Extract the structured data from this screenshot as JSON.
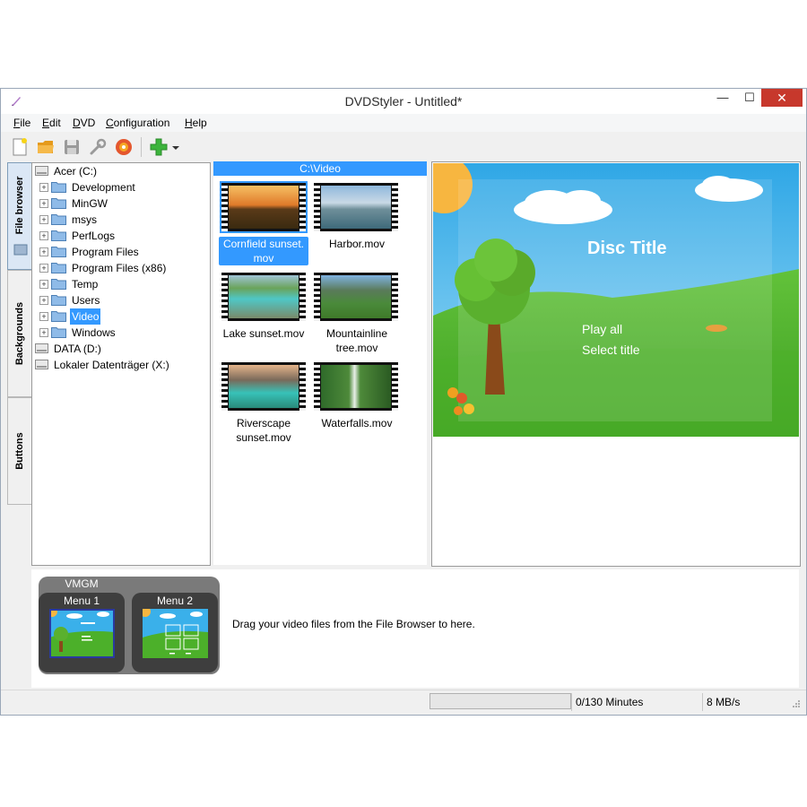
{
  "window": {
    "title": "DVDStyler - Untitled*",
    "controls": {
      "minimize": "—",
      "maximize": "☐",
      "close": "✕"
    }
  },
  "menubar": [
    {
      "underline": "F",
      "rest": "ile"
    },
    {
      "underline": "E",
      "rest": "dit"
    },
    {
      "underline": "D",
      "rest": "VD"
    },
    {
      "underline": "C",
      "rest": "onfiguration"
    },
    {
      "underline": "H",
      "rest": "elp"
    }
  ],
  "toolbar": {
    "icons": [
      "new-file-icon",
      "open-folder-icon",
      "save-icon",
      "settings-wrench-icon",
      "burn-disc-icon",
      "add-icon",
      "dropdown-arrow-icon"
    ]
  },
  "side_tabs": [
    "File browser",
    "Backgrounds",
    "Buttons"
  ],
  "tree": {
    "root": "Acer (C:)",
    "folders": [
      "Development",
      "MinGW",
      "msys",
      "PerfLogs",
      "Program Files",
      "Program Files (x86)",
      "Temp",
      "Users",
      "Video",
      "Windows"
    ],
    "selected": "Video",
    "drives": [
      "DATA (D:)",
      "Lokaler Datenträger (X:)"
    ]
  },
  "file_browser": {
    "path": "C:\\Video",
    "files": [
      {
        "line1": "Cornfield sunset.",
        "line2": "mov",
        "selected": true
      },
      {
        "line1": "Harbor.mov",
        "line2": "",
        "selected": false
      },
      {
        "line1": "Lake sunset.mov",
        "line2": "",
        "selected": false
      },
      {
        "line1": "Mountainline",
        "line2": "tree.mov",
        "selected": false
      },
      {
        "line1": "Riverscape",
        "line2": "sunset.mov",
        "selected": false
      },
      {
        "line1": "Waterfalls.mov",
        "line2": "",
        "selected": false
      }
    ]
  },
  "preview": {
    "disc_title": "Disc Title",
    "buttons": [
      "Play all",
      "Select title"
    ]
  },
  "titleset": {
    "vmgm_label": "VMGM",
    "menus": [
      "Menu 1",
      "Menu 2"
    ],
    "drag_hint": "Drag your video files from the File Browser to here."
  },
  "status": {
    "progress_fraction": 0.0,
    "minutes": "0/130 Minutes",
    "rate": "8 MB/s"
  },
  "colors": {
    "selection": "#3399ff",
    "close_button": "#c7382c",
    "sky": "#4fb8ec",
    "grass": "#4cae2a"
  }
}
